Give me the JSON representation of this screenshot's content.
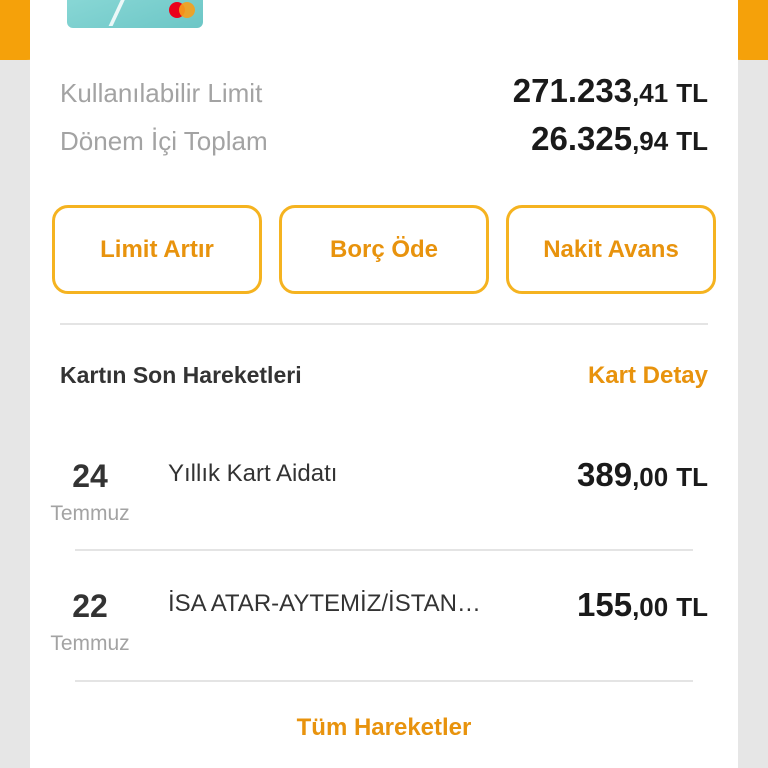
{
  "card": {
    "icon": "mastercard-logo"
  },
  "summary": {
    "available_limit": {
      "label": "Kullanılabilir Limit",
      "integer": "271.233",
      "decimal": ",41",
      "currency": "TL"
    },
    "period_total": {
      "label": "Dönem İçi Toplam",
      "integer": "26.325",
      "decimal": ",94",
      "currency": "TL"
    }
  },
  "actions": {
    "increase_limit": "Limit Artır",
    "pay_debt": "Borç Öde",
    "cash_advance": "Nakit Avans"
  },
  "transactions_section": {
    "title": "Kartın Son Hareketleri",
    "detail_link": "Kart Detay",
    "items": [
      {
        "day": "24",
        "month": "Temmuz",
        "description": "Yıllık Kart Aidatı",
        "integer": "389",
        "decimal": ",00",
        "currency": "TL"
      },
      {
        "day": "22",
        "month": "Temmuz",
        "description": "İSA ATAR-AYTEMİZ/İSTAN…",
        "integer": "155",
        "decimal": ",00",
        "currency": "TL"
      }
    ],
    "all_link": "Tüm Hareketler"
  },
  "colors": {
    "accent": "#f5a10a",
    "link": "#e8930d",
    "button_border": "#f5b320"
  }
}
